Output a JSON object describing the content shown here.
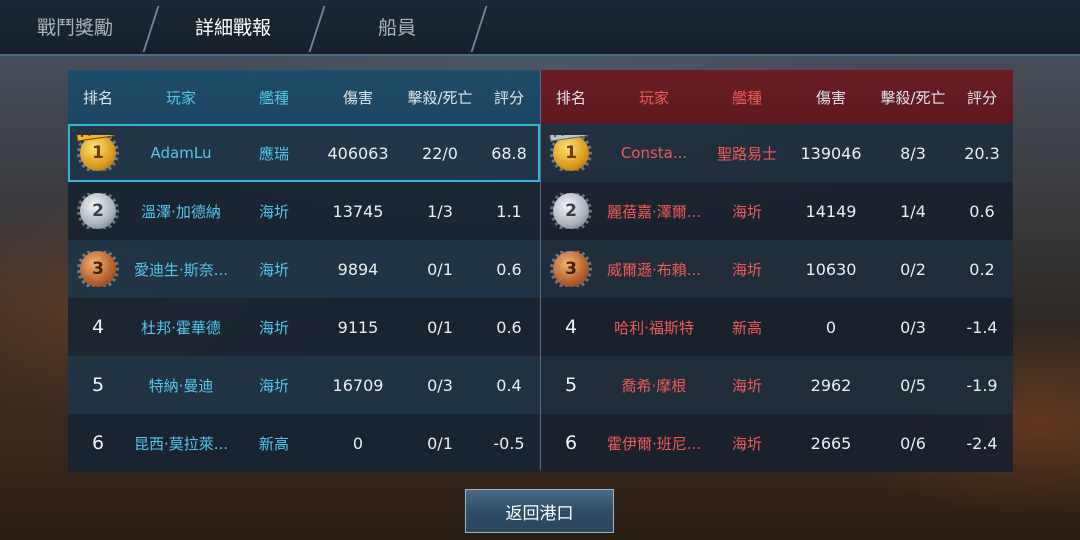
{
  "tabs": [
    {
      "label": "戰鬥獎勵",
      "active": false
    },
    {
      "label": "詳細戰報",
      "active": true
    },
    {
      "label": "船員",
      "active": false
    }
  ],
  "headers": {
    "rank": "排名",
    "player": "玩家",
    "ship": "艦種",
    "damage": "傷害",
    "kd": "擊殺/死亡",
    "score": "評分"
  },
  "team_left": {
    "color": "#52c7ea",
    "header_color": "#1f4c68",
    "rows": [
      {
        "rank": "1",
        "medal": "gold",
        "mvp": "MVP",
        "player": "AdamLu",
        "ship": "應瑞",
        "damage": "406063",
        "kd": "22/0",
        "score": "68.8"
      },
      {
        "rank": "2",
        "medal": "silver",
        "mvp": "",
        "player": "溫澤·加德納",
        "ship": "海圻",
        "damage": "13745",
        "kd": "1/3",
        "score": "1.1"
      },
      {
        "rank": "3",
        "medal": "bronze",
        "mvp": "",
        "player": "愛迪生·斯奈...",
        "ship": "海圻",
        "damage": "9894",
        "kd": "0/1",
        "score": "0.6"
      },
      {
        "rank": "4",
        "medal": "",
        "mvp": "",
        "player": "杜邦·霍華德",
        "ship": "海圻",
        "damage": "9115",
        "kd": "0/1",
        "score": "0.6"
      },
      {
        "rank": "5",
        "medal": "",
        "mvp": "",
        "player": "特納·曼迪",
        "ship": "海圻",
        "damage": "16709",
        "kd": "0/3",
        "score": "0.4"
      },
      {
        "rank": "6",
        "medal": "",
        "mvp": "",
        "player": "昆西·莫拉萊...",
        "ship": "新高",
        "damage": "0",
        "kd": "0/1",
        "score": "-0.5"
      }
    ]
  },
  "team_right": {
    "color": "#ee5a5a",
    "header_color": "#6a1d24",
    "rows": [
      {
        "rank": "1",
        "medal": "gold",
        "mvp": "MVP",
        "player": "Consta...",
        "ship": "聖路易士",
        "damage": "139046",
        "kd": "8/3",
        "score": "20.3"
      },
      {
        "rank": "2",
        "medal": "silver",
        "mvp": "",
        "player": "麗蓓嘉·澤爾...",
        "ship": "海圻",
        "damage": "14149",
        "kd": "1/4",
        "score": "0.6"
      },
      {
        "rank": "3",
        "medal": "bronze",
        "mvp": "",
        "player": "威爾遜·布賴...",
        "ship": "海圻",
        "damage": "10630",
        "kd": "0/2",
        "score": "0.2"
      },
      {
        "rank": "4",
        "medal": "",
        "mvp": "",
        "player": "哈利·福斯特",
        "ship": "新高",
        "damage": "0",
        "kd": "0/3",
        "score": "-1.4"
      },
      {
        "rank": "5",
        "medal": "",
        "mvp": "",
        "player": "喬希·摩根",
        "ship": "海圻",
        "damage": "2962",
        "kd": "0/5",
        "score": "-1.9"
      },
      {
        "rank": "6",
        "medal": "",
        "mvp": "",
        "player": "霍伊爾·班尼...",
        "ship": "海圻",
        "damage": "2665",
        "kd": "0/6",
        "score": "-2.4"
      }
    ]
  },
  "buttons": {
    "return_label": "返回港口"
  }
}
